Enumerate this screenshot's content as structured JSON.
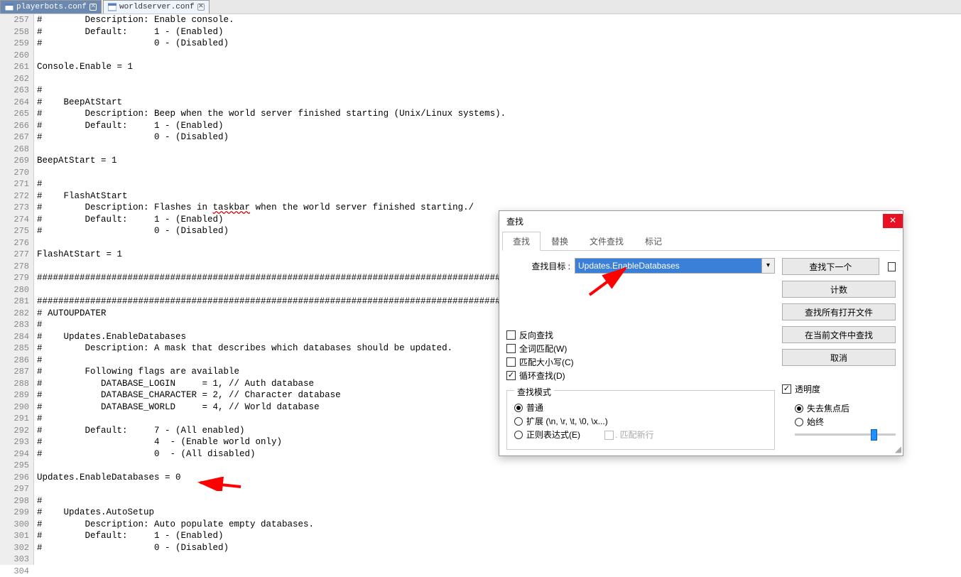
{
  "tabs": [
    {
      "label": "playerbots.conf",
      "active": false
    },
    {
      "label": "worldserver.conf",
      "active": true
    }
  ],
  "gutter_start": 257,
  "highlighted_line_index": 28,
  "highlighted_text": "Updates.EnableDatabases",
  "code_lines": [
    "#        Description: Enable console.",
    "#        Default:     1 - (Enabled)",
    "#                     0 - (Disabled)",
    "",
    "Console.Enable = 1",
    "",
    "#",
    "#    BeepAtStart",
    "#        Description: Beep when the world server finished starting (Unix/Linux systems).",
    "#        Default:     1 - (Enabled)",
    "#                     0 - (Disabled)",
    "",
    "BeepAtStart = 1",
    "",
    "#",
    "#    FlashAtStart",
    "#        Description: Flashes in taskbar when the world server finished starting./",
    "#        Default:     1 - (Enabled)",
    "#                     0 - (Disabled)",
    "",
    "FlashAtStart = 1",
    "",
    "###################################################################################################",
    "",
    "###################################################################################################",
    "# AUTOUPDATER",
    "#",
    "#    Updates.EnableDatabases",
    "#        Description: A mask that describes which databases should be updated.",
    "#",
    "#        Following flags are available",
    "#           DATABASE_LOGIN     = 1, // Auth database",
    "#           DATABASE_CHARACTER = 2, // Character database",
    "#           DATABASE_WORLD     = 4, // World database",
    "#",
    "#        Default:     7 - (All enabled)",
    "#                     4  - (Enable world only)",
    "#                     0  - (All disabled)",
    "",
    "Updates.EnableDatabases = 0",
    "",
    "#",
    "#    Updates.AutoSetup",
    "#        Description: Auto populate empty databases.",
    "#        Default:     1 - (Enabled)",
    "#                     0 - (Disabled)",
    "",
    ""
  ],
  "dialog": {
    "title": "查找",
    "tabs": [
      "查找",
      "替换",
      "文件查找",
      "标记"
    ],
    "active_tab": 0,
    "search_label": "查找目标 :",
    "search_value": "Updates.EnableDatabases",
    "buttons": {
      "find_next": "查找下一个",
      "count": "计数",
      "find_all_open": "查找所有打开文件",
      "find_all_current": "在当前文件中查找",
      "cancel": "取消"
    },
    "checkboxes": {
      "backward": "反向查找",
      "whole_word": "全词匹配(W)",
      "match_case": "匹配大小写(C)",
      "wrap": "循环查找(D)"
    },
    "check_states": {
      "backward": false,
      "whole_word": false,
      "match_case": false,
      "wrap": true
    },
    "mode_group": {
      "legend": "查找模式",
      "normal": "普通",
      "extended": "扩展 (\\n, \\r, \\t, \\0, \\x...)",
      "regex": "正则表达式(E)",
      "match_newline": ". 匹配新行"
    },
    "mode_selected": "normal",
    "transparency": {
      "label": "透明度",
      "checked": true,
      "lose_focus": "失去焦点后",
      "always": "始终",
      "selected": "lose_focus"
    }
  }
}
